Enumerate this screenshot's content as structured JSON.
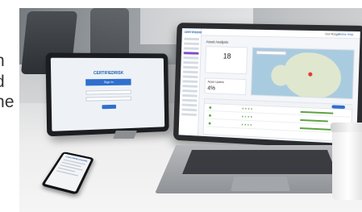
{
  "caption": {
    "line1": "n",
    "line2": "d",
    "line3": "ne"
  },
  "dashboard": {
    "brand": "CERTIFIEDRISK",
    "title": "Asset Analysis",
    "count": "18",
    "uptime_label": "Asset Uptime",
    "uptime_value": "4%",
    "user": "Dell Rutger",
    "help": "Online Help"
  },
  "tablet": {
    "brand": "CERTIFIEDRISK",
    "signin": "Sign In"
  },
  "phone": {
    "brand": "CERTIFIEDRISK"
  },
  "colors": {
    "accent": "#2f6fcf",
    "sidebar_active": "#7d4fc4",
    "status_green": "#5fa344",
    "map_pin": "#e53935"
  }
}
